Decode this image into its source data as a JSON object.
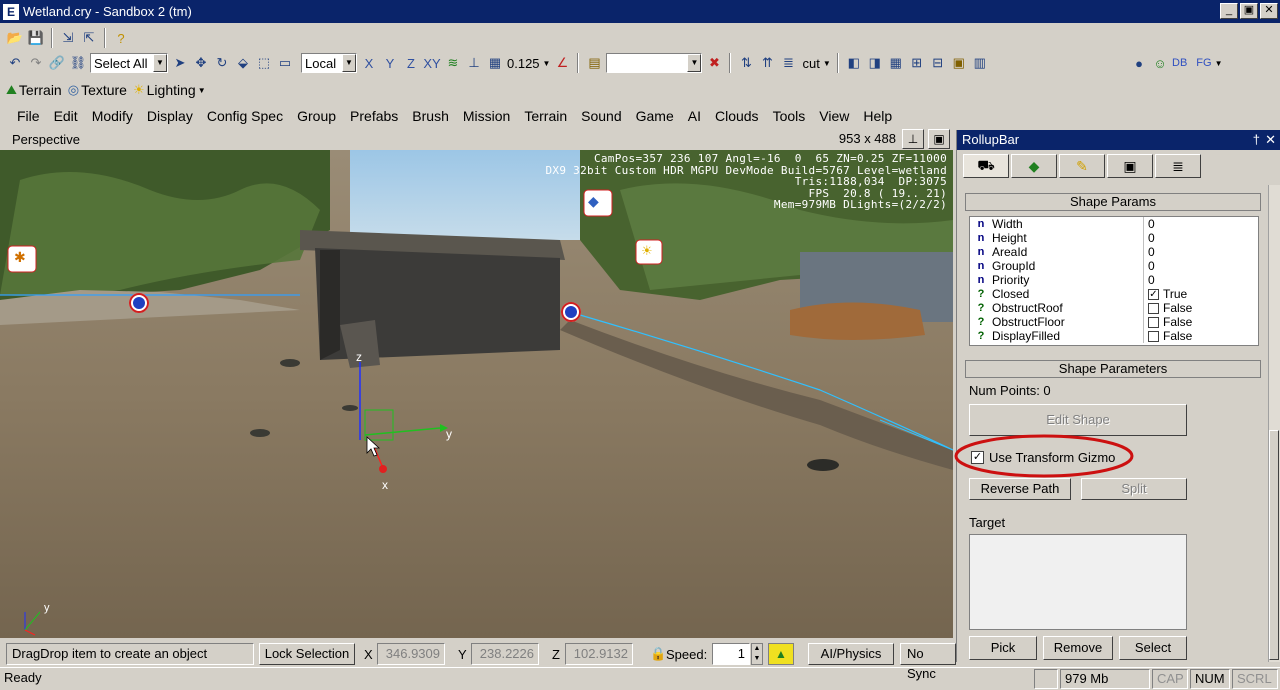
{
  "window": {
    "title": "Wetland.cry - Sandbox 2 (tm)",
    "app_icon": "E",
    "min": "_",
    "max": "▣",
    "close": "✕"
  },
  "toolbar2": {
    "select_combo": "Select All",
    "coord_combo": "Local",
    "axes": [
      "X",
      "Y",
      "Z",
      "XY"
    ],
    "grid_value": "0.125",
    "layer_combo": "cut"
  },
  "toolbar3": {
    "terrain": "Terrain",
    "texture": "Texture",
    "lighting": "Lighting",
    "right_labels": [
      "DB",
      "FG"
    ]
  },
  "menu": [
    "File",
    "Edit",
    "Modify",
    "Display",
    "Config Spec",
    "Group",
    "Prefabs",
    "Brush",
    "Mission",
    "Terrain",
    "Sound",
    "Game",
    "AI",
    "Clouds",
    "Tools",
    "View",
    "Help"
  ],
  "viewport": {
    "label": "Perspective",
    "size": "953 x 488",
    "hud": "CamPos=357 236 107 Angl=-16  0  65 ZN=0.25 ZF=11000\nDX9 32bit Custom HDR MGPU DevMode Build=5767 Level=wetland\nTris:1188,034  DP:3075\nFPS  20.8 ( 19.. 21)\nMem=979MB DLights=(2/2/2)",
    "gizmo_labels": {
      "z": "z",
      "y": "y",
      "x": "x"
    },
    "corner_axis": "y"
  },
  "rollup": {
    "title": "RollupBar",
    "pin": "†",
    "close": "✕",
    "shape_params_header": "Shape Params",
    "props": [
      {
        "icon": "n",
        "name": "Width",
        "value": "0",
        "type": "text"
      },
      {
        "icon": "n",
        "name": "Height",
        "value": "0",
        "type": "text"
      },
      {
        "icon": "n",
        "name": "AreaId",
        "value": "0",
        "type": "text"
      },
      {
        "icon": "n",
        "name": "GroupId",
        "value": "0",
        "type": "text"
      },
      {
        "icon": "n",
        "name": "Priority",
        "value": "0",
        "type": "text"
      },
      {
        "icon": "?",
        "name": "Closed",
        "value": "True",
        "type": "bool",
        "checked": true
      },
      {
        "icon": "?",
        "name": "ObstructRoof",
        "value": "False",
        "type": "bool",
        "checked": false
      },
      {
        "icon": "?",
        "name": "ObstructFloor",
        "value": "False",
        "type": "bool",
        "checked": false
      },
      {
        "icon": "?",
        "name": "DisplayFilled",
        "value": "False",
        "type": "bool",
        "checked": false
      }
    ],
    "shape_parameters_header": "Shape Parameters",
    "num_points": "Num Points: 0",
    "edit_shape": "Edit Shape",
    "use_transform_gizmo": "Use Transform Gizmo",
    "use_transform_gizmo_checked": true,
    "reverse_path": "Reverse Path",
    "split": "Split",
    "target_label": "Target",
    "pick": "Pick",
    "remove": "Remove",
    "select": "Select"
  },
  "statusbar": {
    "hint": "DragDrop item to create an object",
    "lock_selection": "Lock Selection",
    "x_label": "X",
    "x_value": "346.9309",
    "y_label": "Y",
    "y_value": "238.2226",
    "z_label": "Z",
    "z_value": "102.9132",
    "speed_label": "Speed:",
    "speed_value": "1",
    "ai_physics": "AI/Physics",
    "no_sync": "No Sync",
    "ready": "Ready",
    "memory": "979  Mb",
    "cap": "CAP",
    "num": "NUM",
    "scrl": "SCRL"
  },
  "colors": {
    "titlebar": "#0a246a",
    "highlight_circle": "#cc1010",
    "chrome": "#d4d0c8"
  }
}
